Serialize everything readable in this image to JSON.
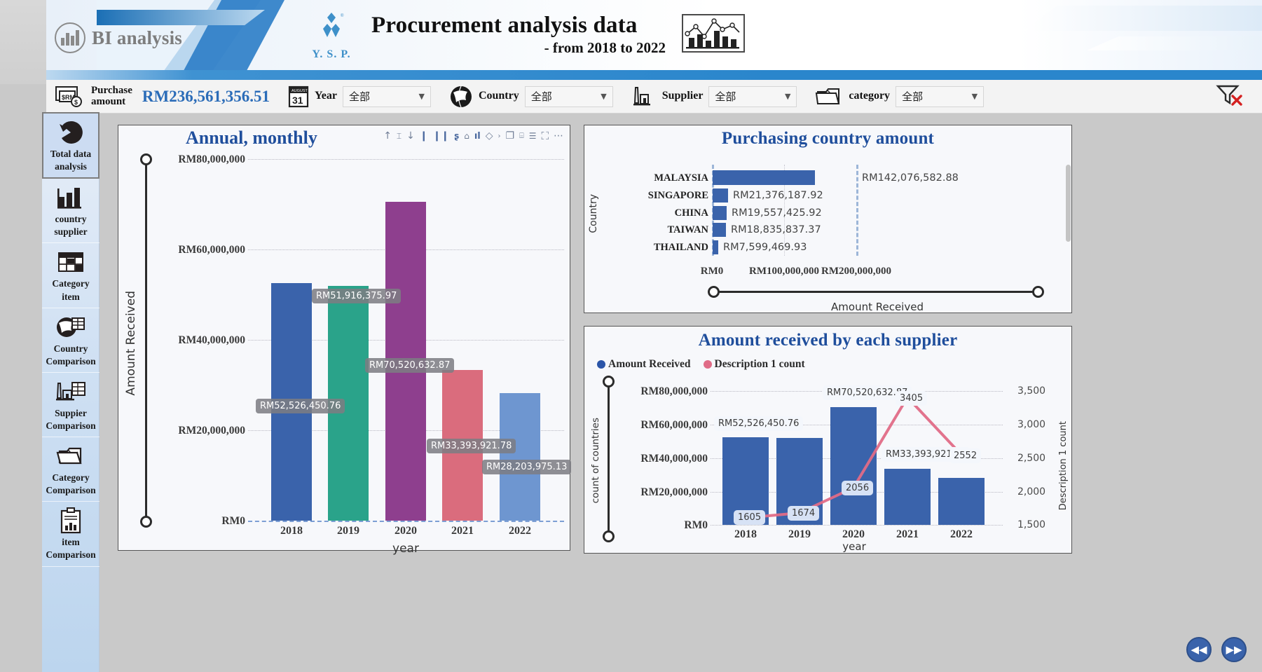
{
  "banner": {
    "bi_logo_text": "BI analysis",
    "company_logo_text": "Y. S. P.",
    "title": "Procurement analysis data",
    "subtitle": "- from 2018 to 2022"
  },
  "filterbar": {
    "purchase_amount_label_line1": "Purchase",
    "purchase_amount_label_line2": "amount",
    "purchase_amount_value": "RM236,561,356.51",
    "year_label": "Year",
    "year_value": "全部",
    "country_label": "Country",
    "country_value": "全部",
    "supplier_label": "Supplier",
    "supplier_value": "全部",
    "category_label": "category",
    "category_value": "全部"
  },
  "sidebar": {
    "items": [
      {
        "label_line1": "Total data",
        "label_line2": "analysis",
        "icon": "pie-chart-icon",
        "active": true
      },
      {
        "label_line1": "country",
        "label_line2": "supplier",
        "icon": "bar-chart-icon",
        "active": false
      },
      {
        "label_line1": "Category",
        "label_line2": "item",
        "icon": "table-grid-icon",
        "active": false
      },
      {
        "label_line1": "Country",
        "label_line2": "Comparison",
        "icon": "globe-table-icon",
        "active": false
      },
      {
        "label_line1": "Suppier",
        "label_line2": "Comparison",
        "icon": "factory-table-icon",
        "active": false
      },
      {
        "label_line1": "Category",
        "label_line2": "Comparison",
        "icon": "folder-icon",
        "active": false
      },
      {
        "label_line1": "item",
        "label_line2": "Comparison",
        "icon": "clipboard-chart-icon",
        "active": false
      }
    ]
  },
  "colors": {
    "accent_blue": "#1f4e9c",
    "bar_blue": "#3a63ab",
    "bar_teal": "#2aa38a",
    "bar_purple": "#8e3f8e",
    "bar_red": "#da6c7d",
    "bar_lightblue": "#6e96d0",
    "line_pink": "#e06c87"
  },
  "annual_panel": {
    "title": "Annual, monthly",
    "toolbar_icons": [
      "sort-asc-icon",
      "filter-icon",
      "sort-desc-icon",
      "bar-icon",
      "columns-icon",
      "spotlight-icon",
      "anchor-icon",
      "drill-icon",
      "pin-icon",
      "chevron-icon",
      "copy-icon",
      "table-icon",
      "menu-icon",
      "focus-icon",
      "more-icon"
    ]
  },
  "country_panel": {
    "title": "Purchasing country amount"
  },
  "supplier_panel": {
    "title": "Amount received by each supplier",
    "legend": [
      {
        "name": "Amount Received",
        "color": "#3a63ab"
      },
      {
        "name": "Description 1 count",
        "color": "#e06c87"
      }
    ]
  },
  "nav_buttons": {
    "prev": "◀◀",
    "next": "▶▶"
  },
  "chart_data": [
    {
      "type": "bar",
      "id": "annual-monthly",
      "title": "Annual, monthly",
      "xlabel": "year",
      "ylabel": "Amount Received",
      "categories": [
        "2018",
        "2019",
        "2020",
        "2021",
        "2022"
      ],
      "values": [
        52526450.76,
        51916375.97,
        70520632.87,
        33393921.78,
        28203975.13
      ],
      "value_labels": [
        "RM52,526,450.76",
        "RM51,916,375.97",
        "RM70,520,632.87",
        "RM33,393,921.78",
        "RM28,203,975.13"
      ],
      "bar_colors": [
        "#3a63ab",
        "#2aa38a",
        "#8e3f8e",
        "#da6c7d",
        "#6e96d0"
      ],
      "ylim": [
        0,
        80000000
      ],
      "yticks": [
        0,
        20000000,
        40000000,
        60000000,
        80000000
      ],
      "ytick_labels": [
        "RM0",
        "RM20,000,000",
        "RM40,000,000",
        "RM60,000,000",
        "RM80,000,000"
      ],
      "grid": true,
      "legend": "none"
    },
    {
      "type": "bar",
      "id": "purchasing-country-amount",
      "title": "Purchasing country amount",
      "orientation": "horizontal",
      "xlabel": "Amount Received",
      "ylabel": "Country",
      "categories": [
        "MALAYSIA",
        "SINGAPORE",
        "CHINA",
        "TAIWAN",
        "THAILAND"
      ],
      "values": [
        142076582.88,
        21376187.92,
        19557425.92,
        18835837.37,
        7599469.93
      ],
      "value_labels": [
        "RM142,076,582.88",
        "RM21,376,187.92",
        "RM19,557,425.92",
        "RM18,835,837.37",
        "RM7,599,469.93"
      ],
      "bar_color": "#3a63ab",
      "xlim": [
        0,
        250000000
      ],
      "xticks": [
        0,
        100000000,
        200000000
      ],
      "xtick_labels": [
        "RM0",
        "RM100,000,000",
        "RM200,000,000"
      ],
      "grid": true,
      "legend": "none"
    },
    {
      "type": "bar",
      "id": "amount-received-by-each-supplier",
      "title": "Amount received by each supplier",
      "xlabel": "year",
      "ylabel": "count of countries",
      "y2label": "Description 1 count",
      "categories": [
        "2018",
        "2019",
        "2020",
        "2021",
        "2022"
      ],
      "series": [
        {
          "name": "Amount Received",
          "type": "bar",
          "color": "#3a63ab",
          "values": [
            52526450.76,
            51916375.97,
            70520632.87,
            33393921.78,
            28203975.13
          ],
          "value_labels": [
            "RM52,526,450.76",
            "",
            "RM70,520,632.87",
            "RM33,393,921.78",
            ""
          ]
        },
        {
          "name": "Description 1 count",
          "type": "line",
          "color": "#e06c87",
          "values": [
            1605,
            1674,
            2056,
            3405,
            2552
          ],
          "value_labels": [
            "1605",
            "1674",
            "2056",
            "3405",
            "2552"
          ]
        }
      ],
      "ylim": [
        0,
        80000000
      ],
      "yticks": [
        0,
        20000000,
        40000000,
        60000000,
        80000000
      ],
      "ytick_labels": [
        "RM0",
        "RM20,000,000",
        "RM40,000,000",
        "RM60,000,000",
        "RM80,000,000"
      ],
      "y2lim": [
        1500,
        3500
      ],
      "y2ticks": [
        1500,
        2000,
        2500,
        3000,
        3500
      ],
      "y2tick_labels": [
        "1,500",
        "2,000",
        "2,500",
        "3,000",
        "3,500"
      ],
      "grid": true,
      "legend": "top-left"
    }
  ]
}
